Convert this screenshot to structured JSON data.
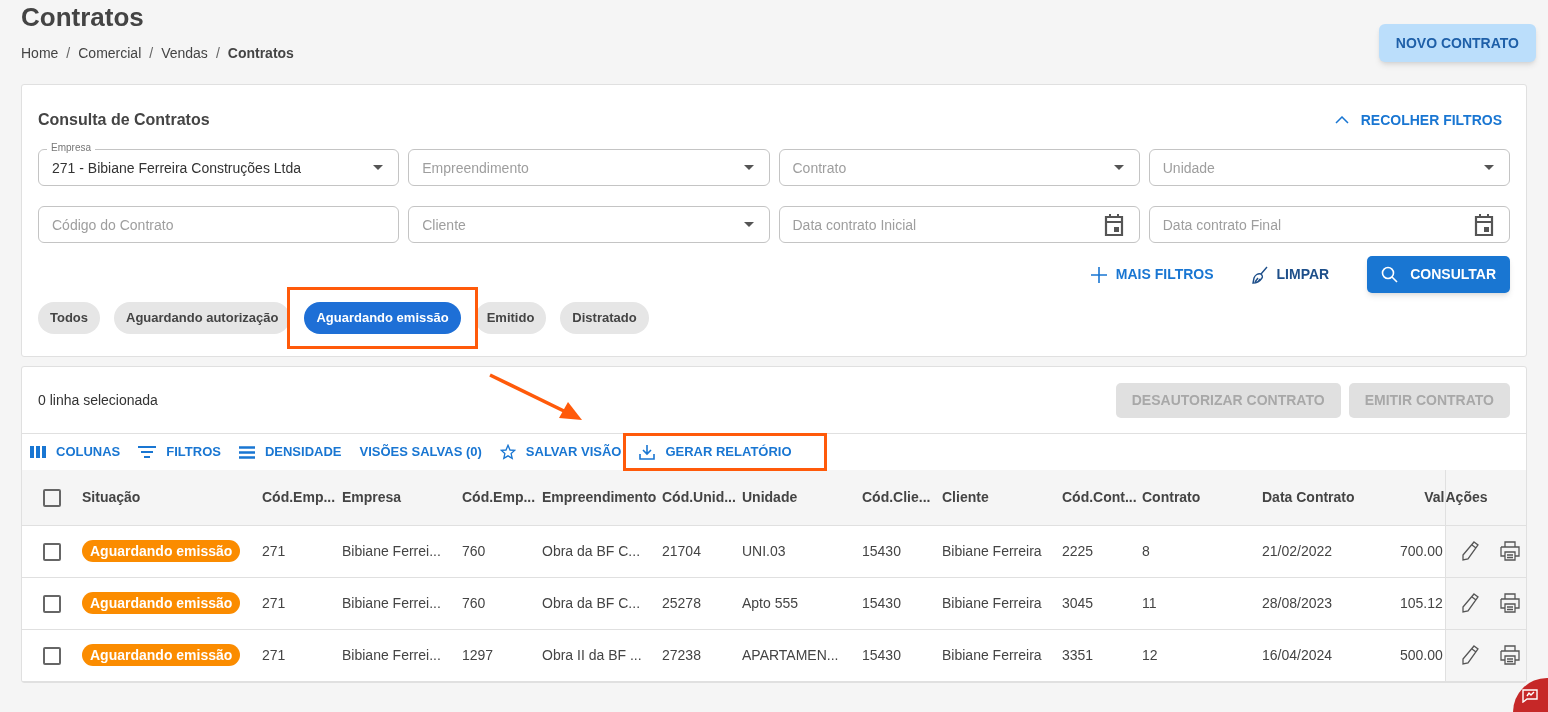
{
  "page": {
    "title": "Contratos",
    "action": "NOVO CONTRATO"
  },
  "breadcrumb": {
    "separators": [
      "/",
      "/",
      "/"
    ],
    "items": [
      {
        "label": "Home",
        "current": false
      },
      {
        "label": "Comercial",
        "current": false
      },
      {
        "label": "Vendas",
        "current": false
      },
      {
        "label": "Contratos",
        "current": true
      }
    ]
  },
  "filters": {
    "title": "Consulta de Contratos",
    "collapse": "RECOLHER FILTROS",
    "fields": [
      {
        "kind": "select",
        "label": "Empresa",
        "value": "271 - Bibiane Ferreira Construções Ltda"
      },
      {
        "kind": "select",
        "placeholder": "Empreendimento"
      },
      {
        "kind": "select",
        "placeholder": "Contrato"
      },
      {
        "kind": "select",
        "placeholder": "Unidade"
      },
      {
        "kind": "text",
        "placeholder": "Código do Contrato"
      },
      {
        "kind": "select",
        "placeholder": "Cliente"
      },
      {
        "kind": "date",
        "placeholder": "Data contrato Inicial"
      },
      {
        "kind": "date",
        "placeholder": "Data contrato Final"
      }
    ],
    "more": "MAIS FILTROS",
    "clear": "LIMPAR",
    "search": "CONSULTAR",
    "chips": [
      {
        "label": "Todos",
        "selected": false,
        "highlighted": false
      },
      {
        "label": "Aguardando autorização",
        "selected": false,
        "highlighted": false
      },
      {
        "label": "Aguardando emissão",
        "selected": true,
        "highlighted": true
      },
      {
        "label": "Emitido",
        "selected": false,
        "highlighted": false
      },
      {
        "label": "Distratado",
        "selected": false,
        "highlighted": false
      }
    ]
  },
  "annotation": {
    "color": "#ff5a0a",
    "arrow": true
  },
  "grid": {
    "selection": "0 linha selecionada",
    "actions": [
      {
        "label": "DESAUTORIZAR CONTRATO",
        "disabled": true
      },
      {
        "label": "EMITIR CONTRATO",
        "disabled": true
      }
    ],
    "toolbar": [
      {
        "kind": "columns",
        "label": "COLUNAS",
        "highlighted": false
      },
      {
        "kind": "filter",
        "label": "FILTROS",
        "highlighted": false
      },
      {
        "kind": "density",
        "label": "DENSIDADE",
        "highlighted": false
      },
      {
        "kind": "views",
        "label": "VISÕES SALVAS (0)",
        "highlighted": false
      },
      {
        "kind": "star",
        "label": "SALVAR VISÃO",
        "highlighted": false
      },
      {
        "kind": "download",
        "label": "GERAR RELATÓRIO",
        "highlighted": true
      }
    ],
    "columns": [
      "Situação",
      "Cód.Emp...",
      "Empresa",
      "Cód.Emp...",
      "Empreendimento",
      "Cód.Unid...",
      "Unidade",
      "Cód.Clie...",
      "Cliente",
      "Cód.Cont...",
      "Contrato",
      "Data Contrato",
      "Val",
      "Ações"
    ],
    "all_checked": false,
    "rows": [
      {
        "checked": false,
        "color": "#fb8c00",
        "cells": [
          "Aguardando emissão",
          "271",
          "Bibiane Ferrei...",
          "760",
          "Obra da BF C...",
          "21704",
          "UNI.03",
          "15430",
          "Bibiane Ferreira",
          "2225",
          "8",
          "21/02/2022",
          "700.00"
        ]
      },
      {
        "checked": false,
        "color": "#fb8c00",
        "cells": [
          "Aguardando emissão",
          "271",
          "Bibiane Ferrei...",
          "760",
          "Obra da BF C...",
          "25278",
          "Apto 555",
          "15430",
          "Bibiane Ferreira",
          "3045",
          "11",
          "28/08/2023",
          "105.12"
        ]
      },
      {
        "checked": false,
        "color": "#fb8c00",
        "cells": [
          "Aguardando emissão",
          "271",
          "Bibiane Ferrei...",
          "1297",
          "Obra II da BF ...",
          "27238",
          "APARTAMEN...",
          "15430",
          "Bibiane Ferreira",
          "3351",
          "12",
          "16/04/2024",
          "500.00"
        ]
      }
    ]
  }
}
